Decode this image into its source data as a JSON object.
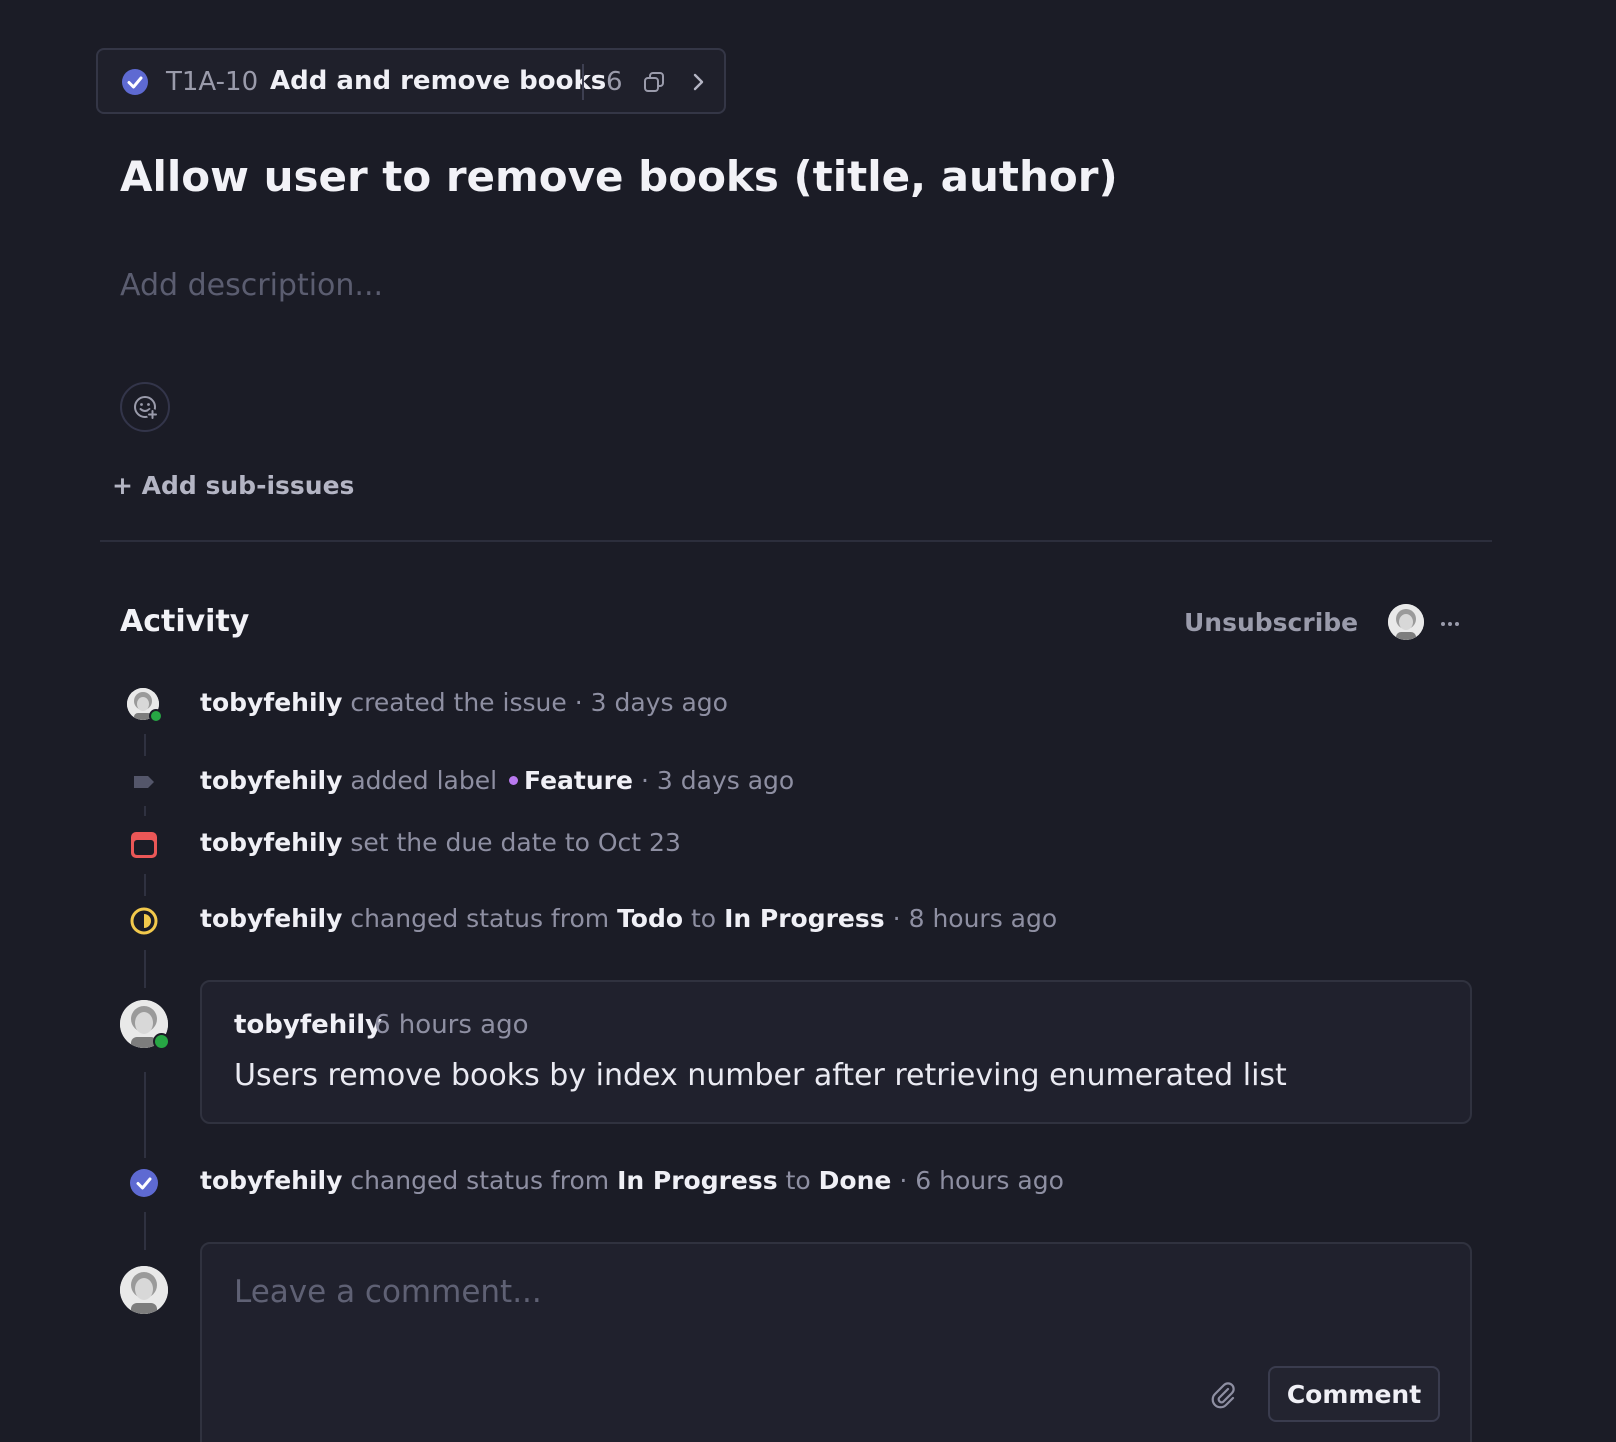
{
  "parent_issue": {
    "id": "T1A-10",
    "title": "Add and remove books",
    "sub_issue_count": "6"
  },
  "issue": {
    "title": "Allow user to remove books (title, author)",
    "description_placeholder": "Add description...",
    "add_sub_issues_label": "+ Add sub-issues"
  },
  "activity": {
    "heading": "Activity",
    "unsubscribe_label": "Unsubscribe",
    "events": [
      {
        "user": "tobyfehily",
        "text": "created the issue",
        "time": "3 days ago"
      },
      {
        "user": "tobyfehily",
        "text": "added label",
        "label": "Feature",
        "time": "3 days ago"
      },
      {
        "user": "tobyfehily",
        "text": "set the due date to Oct 23"
      },
      {
        "user": "tobyfehily",
        "text": "changed status from",
        "from": "Todo",
        "to_word": "to",
        "to": "In Progress",
        "time": "8 hours ago"
      },
      {
        "user": "tobyfehily",
        "text": "changed status from",
        "from": "In Progress",
        "to_word": "to",
        "to": "Done",
        "time": "6 hours ago"
      }
    ],
    "comment": {
      "user": "tobyfehily",
      "time": "6 hours ago",
      "body": "Users remove books by index number after retrieving enumerated list"
    }
  },
  "compose": {
    "placeholder": "Leave a comment...",
    "submit_label": "Comment"
  },
  "colors": {
    "background": "#1b1c26",
    "done_status": "#5e6ad2",
    "in_progress_status": "#f2c94c",
    "due_date": "#eb5757",
    "feature_label": "#b979f0",
    "presence": "#27a644"
  }
}
